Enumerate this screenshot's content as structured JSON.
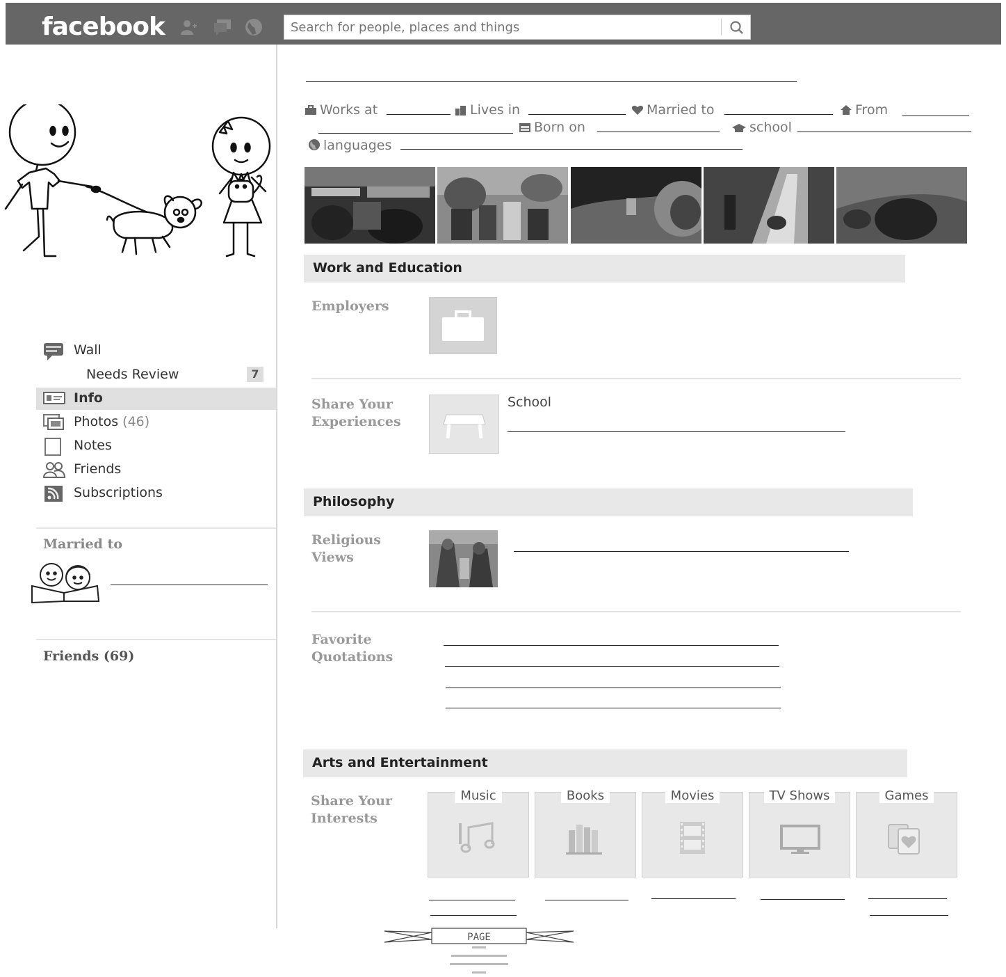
{
  "header": {
    "logo": "facebook",
    "search_placeholder": "Search for people, places and things"
  },
  "sidebar": {
    "nav": [
      {
        "label": "Wall",
        "icon": "wall-icon"
      },
      {
        "label": "Needs Review",
        "badge": "7"
      },
      {
        "label": "Info",
        "icon": "info-icon"
      },
      {
        "label": "Photos",
        "count": "(46)",
        "icon": "photos-icon"
      },
      {
        "label": "Notes",
        "icon": "notes-icon"
      },
      {
        "label": "Friends",
        "icon": "friends-icon"
      },
      {
        "label": "Subscriptions",
        "icon": "subscriptions-icon"
      }
    ],
    "married_heading": "Married to",
    "friends_heading": "Friends (69)"
  },
  "facts": {
    "works_at": "Works at",
    "lives_in": "Lives in",
    "married_to": "Married to",
    "from": "From",
    "born_on": "Born on",
    "school": "school",
    "languages": "languages"
  },
  "work_education": {
    "title": "Work and Education",
    "employers": "Employers",
    "experiences": "Share Your Experiences",
    "school_label": "School"
  },
  "philosophy": {
    "title": "Philosophy",
    "religious": "Religious Views",
    "quotations": "Favorite Quotations"
  },
  "arts": {
    "title": "Arts and Entertainment",
    "interests": "Share Your Interests",
    "categories": [
      "Music",
      "Books",
      "Movies",
      "TV Shows",
      "Games"
    ]
  },
  "stamp": {
    "text": "PAGE"
  }
}
